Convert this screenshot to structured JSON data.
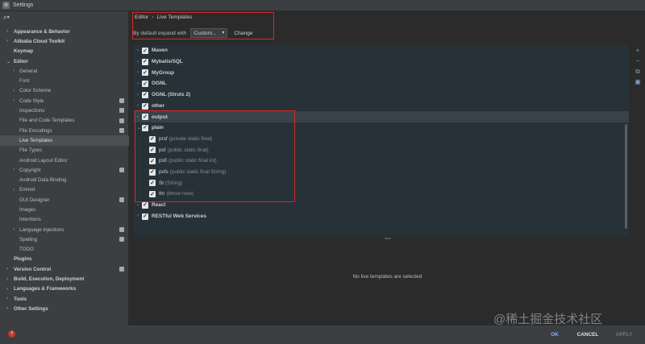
{
  "window": {
    "title": "Settings"
  },
  "sidebar": {
    "search_icon": "search-icon",
    "items": [
      {
        "label": "Appearance & Behavior",
        "level": 0,
        "arrow": "›"
      },
      {
        "label": "Alibaba Cloud Toolkit",
        "level": 0,
        "arrow": "›"
      },
      {
        "label": "Keymap",
        "level": 0,
        "arrow": ""
      },
      {
        "label": "Editor",
        "level": 0,
        "arrow": "⌄"
      },
      {
        "label": "General",
        "level": 1,
        "arrow": "›"
      },
      {
        "label": "Font",
        "level": 1,
        "arrow": ""
      },
      {
        "label": "Color Scheme",
        "level": 1,
        "arrow": "›"
      },
      {
        "label": "Code Style",
        "level": 1,
        "arrow": "›",
        "project": true
      },
      {
        "label": "Inspections",
        "level": 1,
        "arrow": "",
        "project": true
      },
      {
        "label": "File and Code Templates",
        "level": 1,
        "arrow": "",
        "project": true
      },
      {
        "label": "File Encodings",
        "level": 1,
        "arrow": "",
        "project": true
      },
      {
        "label": "Live Templates",
        "level": 1,
        "arrow": "",
        "selected": true
      },
      {
        "label": "File Types",
        "level": 1,
        "arrow": ""
      },
      {
        "label": "Android Layout Editor",
        "level": 1,
        "arrow": ""
      },
      {
        "label": "Copyright",
        "level": 1,
        "arrow": "›",
        "project": true
      },
      {
        "label": "Android Data Binding",
        "level": 1,
        "arrow": ""
      },
      {
        "label": "Emmet",
        "level": 1,
        "arrow": "›"
      },
      {
        "label": "GUI Designer",
        "level": 1,
        "arrow": "",
        "project": true
      },
      {
        "label": "Images",
        "level": 1,
        "arrow": ""
      },
      {
        "label": "Intentions",
        "level": 1,
        "arrow": ""
      },
      {
        "label": "Language Injections",
        "level": 1,
        "arrow": "›",
        "project": true
      },
      {
        "label": "Spelling",
        "level": 1,
        "arrow": "",
        "project": true
      },
      {
        "label": "TODO",
        "level": 1,
        "arrow": ""
      },
      {
        "label": "Plugins",
        "level": 0,
        "arrow": ""
      },
      {
        "label": "Version Control",
        "level": 0,
        "arrow": "›",
        "project": true
      },
      {
        "label": "Build, Execution, Deployment",
        "level": 0,
        "arrow": "›"
      },
      {
        "label": "Languages & Frameworks",
        "level": 0,
        "arrow": "›"
      },
      {
        "label": "Tools",
        "level": 0,
        "arrow": "›"
      },
      {
        "label": "Other Settings",
        "level": 0,
        "arrow": "›"
      }
    ]
  },
  "main": {
    "breadcrumb": {
      "parent": "Editor",
      "separator": "›",
      "current": "Live Templates"
    },
    "expand": {
      "label": "By default expand with",
      "value": "Custom...",
      "change_label": "Change"
    },
    "groups": [
      {
        "label": "Maven",
        "arrow": "›",
        "checked": true,
        "indent": 0
      },
      {
        "label": "Mybatis/SQL",
        "arrow": "›",
        "checked": true,
        "indent": 0
      },
      {
        "label": "MyGroup",
        "arrow": "›",
        "checked": true,
        "indent": 0
      },
      {
        "label": "OGNL",
        "arrow": "›",
        "checked": true,
        "indent": 0
      },
      {
        "label": "OGNL (Struts 2)",
        "arrow": "›",
        "checked": true,
        "indent": 0
      },
      {
        "label": "other",
        "arrow": "›",
        "checked": true,
        "indent": 0
      },
      {
        "label": "output",
        "arrow": "›",
        "checked": true,
        "indent": 0,
        "highlight": true
      },
      {
        "label": "plain",
        "arrow": "⌄",
        "checked": true,
        "indent": 0
      },
      {
        "label": "prsf",
        "desc": "(private static final)",
        "checked": true,
        "indent": 1
      },
      {
        "label": "psf",
        "desc": "(public static final)",
        "checked": true,
        "indent": 1
      },
      {
        "label": "psfi",
        "desc": "(public static final int)",
        "checked": true,
        "indent": 1
      },
      {
        "label": "psfs",
        "desc": "(public static final String)",
        "checked": true,
        "indent": 1
      },
      {
        "label": "St",
        "desc": "(String)",
        "checked": true,
        "indent": 1
      },
      {
        "label": "thr",
        "desc": "(throw new)",
        "checked": true,
        "indent": 1
      },
      {
        "label": "React",
        "arrow": "›",
        "checked": true,
        "indent": 0
      },
      {
        "label": "RESTful Web Services",
        "arrow": "›",
        "checked": true,
        "indent": 0
      }
    ],
    "tools": [
      "plus-icon",
      "minus-icon",
      "copy-icon",
      "save-icon"
    ],
    "empty_message": "No live templates are selected"
  },
  "footer": {
    "ok_label": "OK",
    "cancel_label": "CANCEL",
    "apply_label": "APPLY"
  },
  "watermark": "@稀土掘金技术社区",
  "colors": {
    "accent_red": "#d42a2a",
    "panel_bg": "#263238",
    "sidebar_bg": "#3c3f41"
  }
}
